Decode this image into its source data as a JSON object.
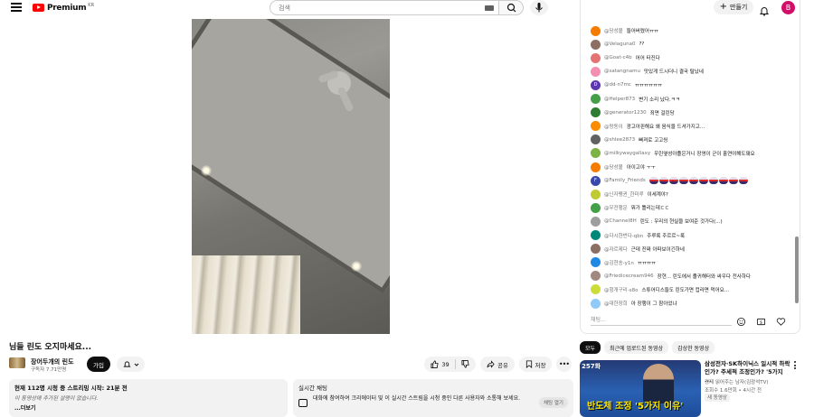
{
  "header": {
    "logo_text": "Premium",
    "logo_region": "KR",
    "search_placeholder": "검색",
    "create_label": "만들기",
    "avatar_letter": "B"
  },
  "video": {
    "title": "님들 린도 오지마세요...",
    "channel_name": "장어두개의 린도",
    "subscribers": "구독자 7.71만명",
    "join_label": "가입",
    "likes": "39",
    "share_label": "공유",
    "save_label": "저장"
  },
  "description": {
    "line1": "현재 112명 시청 중  스트리밍 시작: 21분 전",
    "line2": "이 동영상에 추가된 설명이 없습니다.",
    "more": "...더보기"
  },
  "live_chat_card": {
    "title": "실시간 채팅",
    "text": "대화에 참여하여 크리에이터 및 이 실시간 스트림을 시청 중인 다른 사용자와 소통해 보세요.",
    "open_label": "채팅 열기"
  },
  "chat": {
    "input_placeholder": "채팅...",
    "messages": [
      {
        "author": "@당성볼",
        "text": "들어버렸어ㅠㅠ",
        "color": "#f57c00"
      },
      {
        "author": "@Velaguna0",
        "text": "??",
        "color": "#8d6e63"
      },
      {
        "author": "@Goat-c4b",
        "text": "어어 터진다",
        "color": "#e57373"
      },
      {
        "author": "@satangnamu",
        "text": "맛있게 드시더니 결국 탈났네",
        "color": "#f48fb1"
      },
      {
        "author": "@dd-n7mc",
        "text": "ㅠㅠㅠㅠㅠㅠ",
        "color": "#5e35b1",
        "letter": "D"
      },
      {
        "author": "@Helper873",
        "text": "변기 소리 났다.ㅋㅋ",
        "color": "#43a047"
      },
      {
        "author": "@generator1230",
        "text": "죄면 걸린당",
        "color": "#2e7d32"
      },
      {
        "author": "@랑동이",
        "text": "광고아핀해요 왜 음식을 드셔가지고...",
        "color": "#fb8c00"
      },
      {
        "author": "@shlee2873",
        "text": "빠져로 고고씽",
        "color": "#616161"
      },
      {
        "author": "@milkywaygallaxy",
        "text": "우린옆성아졸은거니 장영이 군이 홀연야해도돼요",
        "color": "#7cb342"
      },
      {
        "author": "@당성볼",
        "text": "아이고야 ㅜㅜ",
        "color": "#f57c00"
      },
      {
        "author": "@Family_Friends",
        "text": "",
        "color": "#3949ab",
        "letter": "F",
        "emoji_count": 10
      },
      {
        "author": "@닌자펭귄_한미루",
        "text": "이세계야?",
        "color": "#c0ca33"
      },
      {
        "author": "@우전행운",
        "text": "뭐가 틀리는데ㄷㄷ",
        "color": "#43a047"
      },
      {
        "author": "@Channel8H",
        "text": "린도 : 우리의 현실을 보여준 것가다(...)",
        "color": "#9e9e9e"
      },
      {
        "author": "@다시한번다-qbn",
        "text": "주루룩 주르르~룩",
        "color": "#00897b"
      },
      {
        "author": "@자르제다",
        "text": "근데 진짜 아파보이긴하네",
        "color": "#8d6e63"
      },
      {
        "author": "@김현송-y1n",
        "text": "ㅠㅠㅠㅠ",
        "color": "#1e88e5"
      },
      {
        "author": "@Friedicecream946",
        "text": "장현... 린도에서 졸귀해터와 싸우다 전사하다",
        "color": "#a1887f"
      },
      {
        "author": "@헝개구리-s8o",
        "text": "스튜어디스들도 린도가면 컵라면 먹어요...",
        "color": "#cddc39"
      },
      {
        "author": "@대한장희",
        "text": "아 장행이 그 참아었냐",
        "color": "#90caf9"
      }
    ]
  },
  "recommendations": {
    "chips": [
      "모두",
      "최근에 업로드된 동영상",
      "감상한 동영상"
    ],
    "item": {
      "thumb_number": "257화",
      "thumb_headline": "반도체 조정 '5가지 이유'",
      "title": "삼성전자·SK하이닉스 일시적 하락인가? 주세적 조정인가? '5가지 ...",
      "channel": "경제 읽어주는 남자(김광석TV)",
      "meta": "조회수 1.6만회 • 4시간 전",
      "badge": "새 동영상"
    }
  },
  "colors": {
    "brand_red": "#ff0000",
    "avatar_pink": "#d10f69",
    "text_primary": "#0f0f0f",
    "text_secondary": "#606060"
  }
}
